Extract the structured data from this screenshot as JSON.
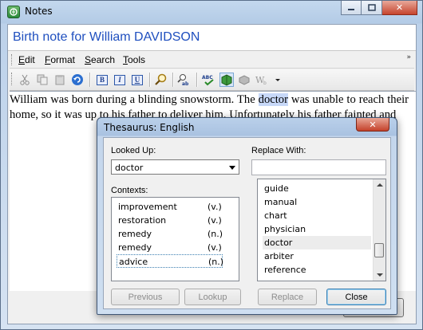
{
  "window": {
    "title": "Notes",
    "heading": "Birth note for William DAVIDSON",
    "menu": [
      {
        "label": "Edit",
        "accel": "E"
      },
      {
        "label": "Format",
        "accel": "F"
      },
      {
        "label": "Search",
        "accel": "S"
      },
      {
        "label": "Tools",
        "accel": "T"
      }
    ],
    "toolbar_icons": [
      "cut-icon",
      "copy-icon",
      "paste-icon",
      "undo-icon",
      "bold-icon",
      "italic-icon",
      "underline-icon",
      "find-icon",
      "replace-icon",
      "spellcheck-icon",
      "thesaurus-icon",
      "web-icon",
      "word-count-icon",
      "more-dropdown-icon"
    ],
    "bold_glyph": "B",
    "italic_glyph": "I",
    "underline_glyph": "U",
    "document": {
      "before": "William was born during a blinding snowstorm.  The ",
      "highlight": "doctor",
      "after": " was unable to reach their home, so it was up to his father to deliver him.  Unfortunately his father fainted and"
    }
  },
  "thesaurus": {
    "title": "Thesaurus: English",
    "looked_up_label": "Looked Up:",
    "looked_up_value": "doctor",
    "replace_with_label": "Replace With:",
    "replace_with_value": "",
    "contexts_label": "Contexts:",
    "contexts": [
      {
        "word": "improvement",
        "pos": "(v.)"
      },
      {
        "word": "restoration",
        "pos": "(v.)"
      },
      {
        "word": "remedy",
        "pos": "(n.)"
      },
      {
        "word": "remedy",
        "pos": "(v.)"
      },
      {
        "word": "advice",
        "pos": "(n.)"
      }
    ],
    "selected_context": 4,
    "replacements": [
      "guide",
      "manual",
      "chart",
      "physician",
      "doctor",
      "arbiter",
      "reference"
    ],
    "selected_replacement": 4,
    "buttons": {
      "previous": "Previous",
      "lookup": "Lookup",
      "replace": "Replace",
      "close": "Close"
    }
  },
  "colors": {
    "heading": "#1f4fbf",
    "highlight": "#c7d8f8",
    "close_button": "#c4412a"
  }
}
